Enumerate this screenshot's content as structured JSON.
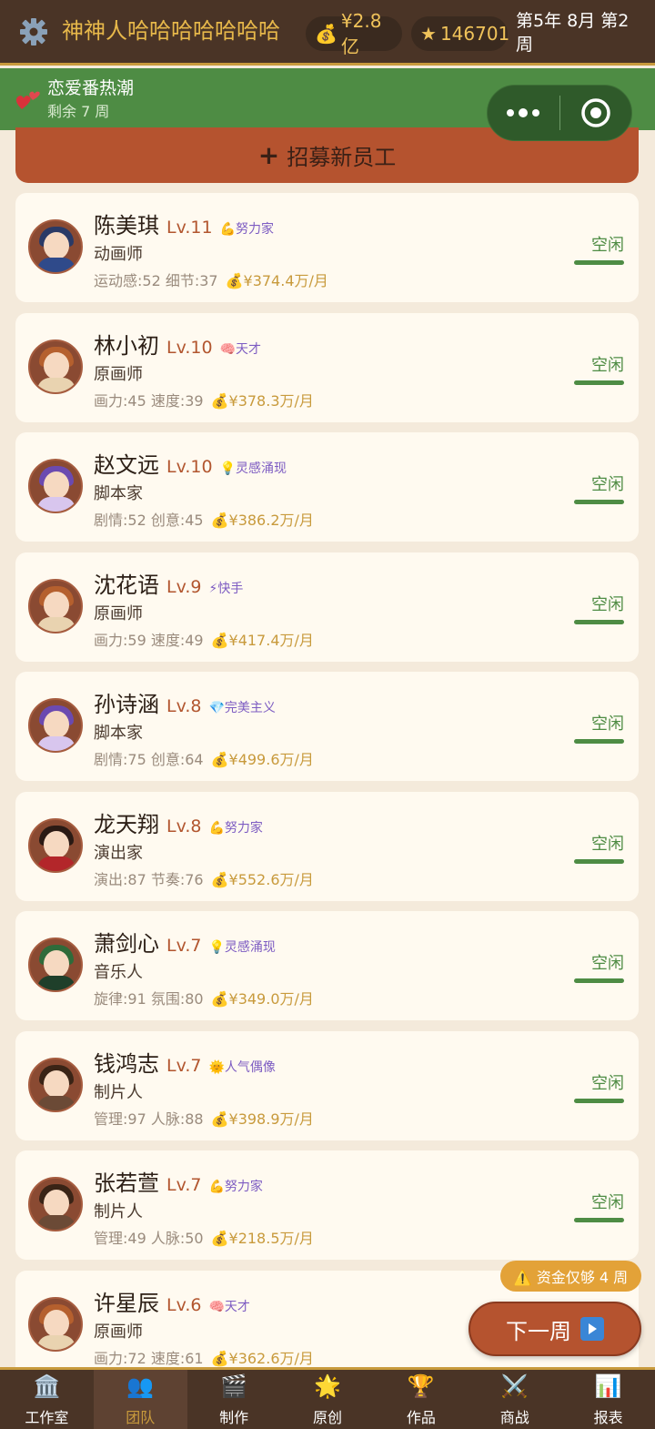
{
  "header": {
    "studio_name": "神神人哈哈哈哈哈哈哈",
    "money": "¥2.8亿",
    "stars": "146701",
    "date": "第5年 8月 第2周"
  },
  "event": {
    "title": "恋爱番热潮",
    "remaining": "剩余 7 周"
  },
  "recruit_label": "招募新员工",
  "employees": [
    {
      "name": "陈美琪",
      "level": "Lv.11",
      "trait": "💪努力家",
      "trait_color": "#7d5cc2",
      "role": "动画师",
      "stats": "运动感:52 细节:37",
      "salary": "💰¥374.4万/月",
      "status": "空闲",
      "avatar_hair": "#2a3a66",
      "avatar_body": "#2f4a8a"
    },
    {
      "name": "林小初",
      "level": "Lv.10",
      "trait": "🧠天才",
      "trait_color": "#7d5cc2",
      "role": "原画师",
      "stats": "画力:45 速度:39",
      "salary": "💰¥378.3万/月",
      "status": "空闲",
      "avatar_hair": "#b5602e",
      "avatar_body": "#e9d3b0"
    },
    {
      "name": "赵文远",
      "level": "Lv.10",
      "trait": "💡灵感涌现",
      "trait_color": "#7d5cc2",
      "role": "脚本家",
      "stats": "剧情:52 创意:45",
      "salary": "💰¥386.2万/月",
      "status": "空闲",
      "avatar_hair": "#6b4ab0",
      "avatar_body": "#d8c6ee"
    },
    {
      "name": "沈花语",
      "level": "Lv.9",
      "trait": "⚡快手",
      "trait_color": "#7d5cc2",
      "role": "原画师",
      "stats": "画力:59 速度:49",
      "salary": "💰¥417.4万/月",
      "status": "空闲",
      "avatar_hair": "#b5602e",
      "avatar_body": "#e9d3b0"
    },
    {
      "name": "孙诗涵",
      "level": "Lv.8",
      "trait": "💎完美主义",
      "trait_color": "#7d5cc2",
      "role": "脚本家",
      "stats": "剧情:75 创意:64",
      "salary": "💰¥499.6万/月",
      "status": "空闲",
      "avatar_hair": "#6b4ab0",
      "avatar_body": "#d8c6ee"
    },
    {
      "name": "龙天翔",
      "level": "Lv.8",
      "trait": "💪努力家",
      "trait_color": "#7d5cc2",
      "role": "演出家",
      "stats": "演出:87 节奏:76",
      "salary": "💰¥552.6万/月",
      "status": "空闲",
      "avatar_hair": "#2b1a14",
      "avatar_body": "#b3262a"
    },
    {
      "name": "萧剑心",
      "level": "Lv.7",
      "trait": "💡灵感涌现",
      "trait_color": "#7d5cc2",
      "role": "音乐人",
      "stats": "旋律:91 氛围:80",
      "salary": "💰¥349.0万/月",
      "status": "空闲",
      "avatar_hair": "#2f6b3a",
      "avatar_body": "#1f3f2a"
    },
    {
      "name": "钱鸿志",
      "level": "Lv.7",
      "trait": "🌞人气偶像",
      "trait_color": "#7d5cc2",
      "role": "制片人",
      "stats": "管理:97 人脉:88",
      "salary": "💰¥398.9万/月",
      "status": "空闲",
      "avatar_hair": "#3a2416",
      "avatar_body": "#6b4a36"
    },
    {
      "name": "张若萱",
      "level": "Lv.7",
      "trait": "💪努力家",
      "trait_color": "#7d5cc2",
      "role": "制片人",
      "stats": "管理:49 人脉:50",
      "salary": "💰¥218.5万/月",
      "status": "空闲",
      "avatar_hair": "#3a2416",
      "avatar_body": "#6b4a36"
    },
    {
      "name": "许星辰",
      "level": "Lv.6",
      "trait": "🧠天才",
      "trait_color": "#7d5cc2",
      "role": "原画师",
      "stats": "画力:72 速度:61",
      "salary": "💰¥362.6万/月",
      "status": "空闲",
      "avatar_hair": "#b5602e",
      "avatar_body": "#e9d3b0"
    }
  ],
  "warning": "⚠️ 资金仅够 4 周",
  "next_week_label": "下一周",
  "nav": [
    {
      "label": "工作室",
      "icon": "office-building-icon",
      "glyph": "🏛️"
    },
    {
      "label": "团队",
      "icon": "team-icon",
      "glyph": "👥"
    },
    {
      "label": "制作",
      "icon": "clapperboard-icon",
      "glyph": "🎬"
    },
    {
      "label": "原创",
      "icon": "sparkle-icon",
      "glyph": "🌟"
    },
    {
      "label": "作品",
      "icon": "trophy-icon",
      "glyph": "🏆"
    },
    {
      "label": "商战",
      "icon": "crossed-swords-icon",
      "glyph": "⚔️"
    },
    {
      "label": "报表",
      "icon": "bar-chart-icon",
      "glyph": "📊"
    }
  ],
  "active_tab": "团队",
  "colors": {
    "header_bg": "#4a3426",
    "accent_gold": "#c89a3c",
    "event_green": "#4e8c44",
    "button_red": "#b5532f",
    "card_bg": "#fffaf0",
    "page_bg": "#f4eadb"
  }
}
